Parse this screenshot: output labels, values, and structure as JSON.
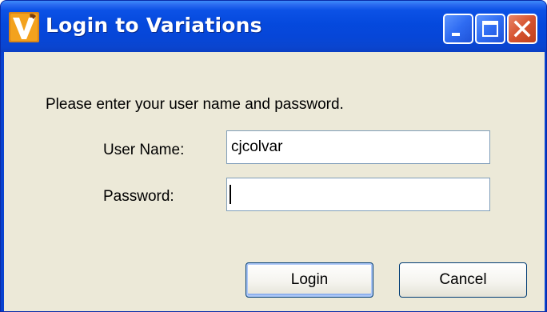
{
  "window": {
    "title": "Login to Variations",
    "app_icon": "variations-logo-icon",
    "controls": {
      "minimize_icon": "minimize-icon",
      "maximize_icon": "maximize-icon",
      "close_icon": "close-icon"
    }
  },
  "form": {
    "prompt": "Please enter your user name and password.",
    "username_label": "User Name:",
    "username_value": "cjcolvar",
    "password_label": "Password:",
    "password_value": ""
  },
  "buttons": {
    "login_label": "Login",
    "cancel_label": "Cancel"
  },
  "colors": {
    "titlebar": "#0549dd",
    "close_button": "#d6532f",
    "dialog_background": "#ece9d8",
    "input_border": "#7f9db9"
  }
}
